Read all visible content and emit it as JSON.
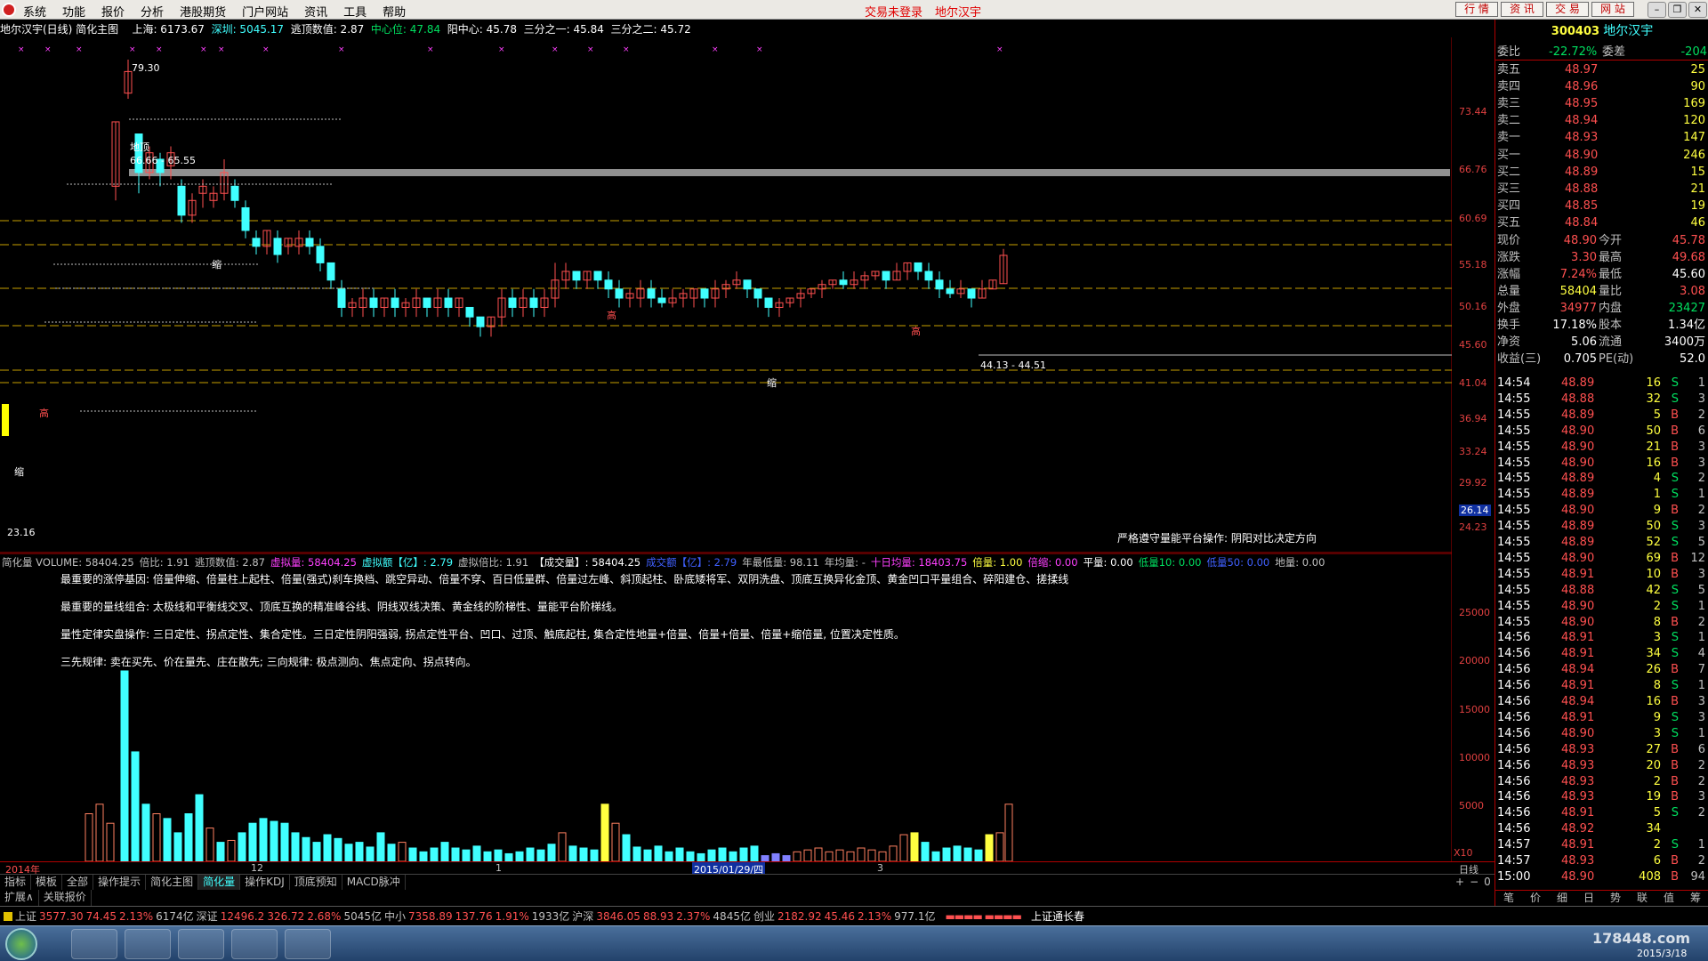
{
  "menu": {
    "items": [
      "系统",
      "功能",
      "报价",
      "分析",
      "港股期货",
      "门户网站",
      "资讯",
      "工具",
      "帮助"
    ],
    "status": [
      "交易未登录",
      "地尔汉宇"
    ],
    "buttons": [
      "行 情",
      "资 讯",
      "交 易",
      "网 站"
    ]
  },
  "info": {
    "title": "地尔汉宇(日线) 简化主图",
    "sh": "上海: 6173.67",
    "sz": "深圳: 5045.17",
    "escape": "逃顶数值: 2.87",
    "center": "中心位: 47.84",
    "yang_center": "阳中心: 45.78",
    "third1": "三分之一: 45.84",
    "third2": "三分之二: 45.72"
  },
  "price_axis": [
    "73.44",
    "66.76",
    "60.69",
    "55.18",
    "50.16",
    "45.60",
    "41.04",
    "36.94",
    "33.24",
    "29.92",
    "26.14",
    "24.23"
  ],
  "chart_labels": {
    "high": "79.30",
    "low": "23.16",
    "range1": "66.66 - 65.55",
    "range2": "44.13 - 44.51",
    "top": "地顶",
    "shrink": "缩",
    "high_mark": "高",
    "note": "严格遵守量能平台操作: 阴阳对比决定方向"
  },
  "volume": {
    "header": [
      {
        "t": "简化量 VOLUME: 58404.25",
        "c": "gry"
      },
      {
        "t": "倍比: 1.91",
        "c": "gry"
      },
      {
        "t": "逃顶数值: 2.87",
        "c": "gry"
      },
      {
        "t": "虚拟量: 58404.25",
        "c": "mag"
      },
      {
        "t": "虚拟额【亿】: 2.79",
        "c": "cyn"
      },
      {
        "t": "虚拟倍比: 1.91",
        "c": "gry"
      },
      {
        "t": "【成交量】: 58404.25",
        "c": "wht"
      },
      {
        "t": "成交额【亿】: 2.79",
        "c": "blu"
      },
      {
        "t": "年最低量: 98.11",
        "c": "gry"
      },
      {
        "t": "年均量: -",
        "c": "gry"
      },
      {
        "t": "十日均量: 18403.75",
        "c": "mag"
      },
      {
        "t": "倍量: 1.00",
        "c": "yel"
      },
      {
        "t": "倍缩: 0.00",
        "c": "mag"
      },
      {
        "t": "平量: 0.00",
        "c": "wht"
      },
      {
        "t": "低量10: 0.00",
        "c": "grn"
      },
      {
        "t": "低量50: 0.00",
        "c": "blu"
      },
      {
        "t": "地量: 0.00",
        "c": "gry"
      }
    ],
    "notes": [
      "最重要的涨停基因: 倍量伸缩、倍量柱上起柱、倍量(强式)刹车换档、跳空异动、倍量不穿、百日低量群、倍量过左峰、斜顶起柱、卧底矮将军、双阴洗盘、顶底互换异化金顶、黄金凹口平量组合、碎阳建仓、搓揉线",
      "最重要的量线组合: 太极线和平衡线交叉、顶底互换的精准峰谷线、阴线双线决策、黄金线的阶梯性、量能平台阶梯线。",
      "量性定律实盘操作: 三日定性、拐点定性、集合定性。三日定性阴阳强弱, 拐点定性平台、凹口、过顶、触底起柱, 集合定性地量+倍量、倍量+倍量、倍量+缩倍量, 位置决定性质。",
      "三先规律: 卖在买先、价在量先、庄在散先; 三向规律: 极点测向、焦点定向、拐点转向。"
    ],
    "axis": [
      "25000",
      "20000",
      "15000",
      "10000",
      "5000",
      "X10"
    ]
  },
  "date_axis": {
    "year": "2014年",
    "m12": "12",
    "m1": "1",
    "sel": "2015/01/29/四",
    "m3": "3",
    "period": "日线"
  },
  "tabs": [
    "指标",
    "模板",
    "全部",
    "操作提示",
    "简化主图",
    "简化量",
    "操作KDJ",
    "顶底预知",
    "MACD脉冲"
  ],
  "ext": [
    "扩展∧",
    "关联报价"
  ],
  "quote": {
    "code": "300403",
    "name": "地尔汉宇",
    "wb_label": "委比",
    "wb": "-22.72%",
    "wc_label": "委差",
    "wc": "-204",
    "asks": [
      {
        "l": "卖五",
        "p": "48.97",
        "v": "25"
      },
      {
        "l": "卖四",
        "p": "48.96",
        "v": "90"
      },
      {
        "l": "卖三",
        "p": "48.95",
        "v": "169"
      },
      {
        "l": "卖二",
        "p": "48.94",
        "v": "120"
      },
      {
        "l": "卖一",
        "p": "48.93",
        "v": "147"
      }
    ],
    "bids": [
      {
        "l": "买一",
        "p": "48.90",
        "v": "246"
      },
      {
        "l": "买二",
        "p": "48.89",
        "v": "15"
      },
      {
        "l": "买三",
        "p": "48.88",
        "v": "21"
      },
      {
        "l": "买四",
        "p": "48.85",
        "v": "19"
      },
      {
        "l": "买五",
        "p": "48.84",
        "v": "46"
      }
    ],
    "stats": [
      {
        "a": "现价",
        "b": "48.90",
        "c": "今开",
        "d": "45.78",
        "bc": "red",
        "dc": "red"
      },
      {
        "a": "涨跌",
        "b": "3.30",
        "c": "最高",
        "d": "49.68",
        "bc": "red",
        "dc": "red"
      },
      {
        "a": "涨幅",
        "b": "7.24%",
        "c": "最低",
        "d": "45.60",
        "bc": "red",
        "dc": "wht"
      },
      {
        "a": "总量",
        "b": "58404",
        "c": "量比",
        "d": "3.08",
        "bc": "yel",
        "dc": "red"
      },
      {
        "a": "外盘",
        "b": "34977",
        "c": "内盘",
        "d": "23427",
        "bc": "red",
        "dc": "grn"
      },
      {
        "a": "换手",
        "b": "17.18%",
        "c": "股本",
        "d": "1.34亿",
        "bc": "wht",
        "dc": "wht"
      },
      {
        "a": "净资",
        "b": "5.06",
        "c": "流通",
        "d": "3400万",
        "bc": "wht",
        "dc": "wht"
      },
      {
        "a": "收益(三)",
        "b": "0.705",
        "c": "PE(动)",
        "d": "52.0",
        "bc": "wht",
        "dc": "wht"
      }
    ],
    "ticks": [
      [
        "14:54",
        "48.89",
        "16",
        "S",
        "1"
      ],
      [
        "14:55",
        "48.88",
        "32",
        "S",
        "3"
      ],
      [
        "14:55",
        "48.89",
        "5",
        "B",
        "2"
      ],
      [
        "14:55",
        "48.90",
        "50",
        "B",
        "6"
      ],
      [
        "14:55",
        "48.90",
        "21",
        "B",
        "3"
      ],
      [
        "14:55",
        "48.90",
        "16",
        "B",
        "3"
      ],
      [
        "14:55",
        "48.89",
        "4",
        "S",
        "2"
      ],
      [
        "14:55",
        "48.89",
        "1",
        "S",
        "1"
      ],
      [
        "14:55",
        "48.90",
        "9",
        "B",
        "2"
      ],
      [
        "14:55",
        "48.89",
        "50",
        "S",
        "3"
      ],
      [
        "14:55",
        "48.89",
        "52",
        "S",
        "5"
      ],
      [
        "14:55",
        "48.90",
        "69",
        "B",
        "12"
      ],
      [
        "14:55",
        "48.91",
        "10",
        "B",
        "3"
      ],
      [
        "14:55",
        "48.88",
        "42",
        "S",
        "5"
      ],
      [
        "14:55",
        "48.90",
        "2",
        "S",
        "1"
      ],
      [
        "14:55",
        "48.90",
        "8",
        "B",
        "2"
      ],
      [
        "14:56",
        "48.91",
        "3",
        "S",
        "1"
      ],
      [
        "14:56",
        "48.91",
        "34",
        "S",
        "4"
      ],
      [
        "14:56",
        "48.94",
        "26",
        "B",
        "7"
      ],
      [
        "14:56",
        "48.91",
        "8",
        "S",
        "1"
      ],
      [
        "14:56",
        "48.94",
        "16",
        "B",
        "3"
      ],
      [
        "14:56",
        "48.91",
        "9",
        "S",
        "3"
      ],
      [
        "14:56",
        "48.90",
        "3",
        "S",
        "1"
      ],
      [
        "14:56",
        "48.93",
        "27",
        "B",
        "6"
      ],
      [
        "14:56",
        "48.93",
        "20",
        "B",
        "2"
      ],
      [
        "14:56",
        "48.93",
        "2",
        "B",
        "2"
      ],
      [
        "14:56",
        "48.93",
        "19",
        "B",
        "3"
      ],
      [
        "14:56",
        "48.91",
        "5",
        "S",
        "2"
      ],
      [
        "14:56",
        "48.92",
        "34",
        "",
        ""
      ],
      [
        "14:57",
        "48.91",
        "2",
        "S",
        "1"
      ],
      [
        "14:57",
        "48.93",
        "6",
        "B",
        "2"
      ],
      [
        "15:00",
        "48.90",
        "408",
        "B",
        "94"
      ]
    ],
    "bottom_tabs": [
      "笔",
      "价",
      "细",
      "日",
      "势",
      "联",
      "值",
      "筹"
    ]
  },
  "status": {
    "sh_label": "上证",
    "sh": "3577.30",
    "sh_chg": "74.45",
    "sh_pct": "2.13%",
    "sh_amt": "6174亿",
    "szz_label": "深证",
    "szz": "12496.2",
    "szz_chg": "326.72",
    "szz_pct": "2.68%",
    "szz_amt": "5045亿",
    "zx_label": "中小",
    "zx": "7358.89",
    "zx_chg": "137.76",
    "zx_pct": "1.91%",
    "zx_amt": "1933亿",
    "hs_label": "沪深",
    "hs": "3846.05",
    "hs_chg": "88.93",
    "hs_pct": "2.37%",
    "hs_amt": "4845亿",
    "cy_label": "创业",
    "cy": "2182.92",
    "cy_chg": "45.46",
    "cy_pct": "2.13%",
    "cy_amt": "977.1亿",
    "ticker": "上证通长春"
  },
  "taskbar": {
    "watermark": "178448.com",
    "date": "2015/3/18"
  },
  "colors": {
    "up": "#ff5050",
    "down": "#40ffff",
    "bg": "#000000",
    "accent": "#b00000"
  }
}
